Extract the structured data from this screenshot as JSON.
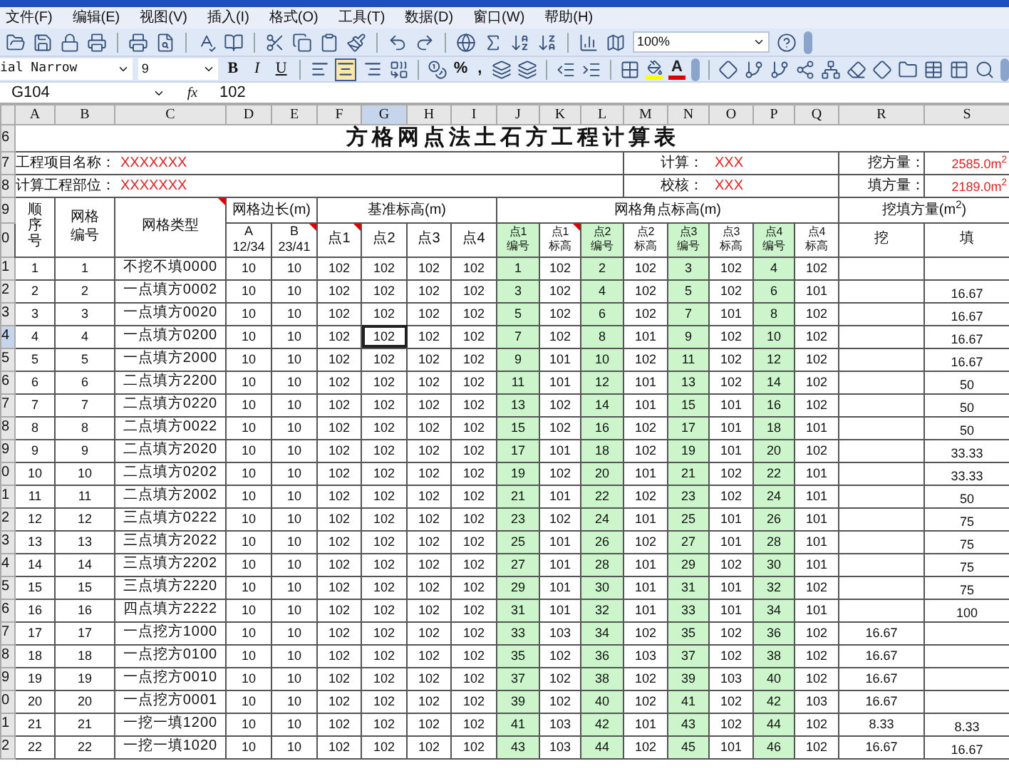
{
  "menu": [
    "文件(F)",
    "编辑(E)",
    "视图(V)",
    "插入(I)",
    "格式(O)",
    "工具(T)",
    "数据(D)",
    "窗口(W)",
    "帮助(H)"
  ],
  "toolbar": {
    "zoom": "100%",
    "font": "ial Narrow",
    "size": "9",
    "style_buttons": [
      "B",
      "I",
      "U"
    ],
    "align_buttons": [
      {
        "selected": false
      },
      {
        "selected": true
      },
      {
        "selected": false
      }
    ],
    "percent": "%",
    "comma": ",",
    "font_color": "A"
  },
  "formula_bar": {
    "name_box": "G104",
    "fx": "fx",
    "value": "102"
  },
  "columns": [
    {
      "label": "A",
      "selected": false
    },
    {
      "label": "B",
      "selected": false
    },
    {
      "label": "C",
      "selected": false
    },
    {
      "label": "D",
      "selected": false
    },
    {
      "label": "E",
      "selected": false
    },
    {
      "label": "F",
      "selected": false
    },
    {
      "label": "G",
      "selected": true
    },
    {
      "label": "H",
      "selected": false
    },
    {
      "label": "I",
      "selected": false
    },
    {
      "label": "J",
      "selected": false
    },
    {
      "label": "K",
      "selected": false
    },
    {
      "label": "L",
      "selected": false
    },
    {
      "label": "M",
      "selected": false
    },
    {
      "label": "N",
      "selected": false
    },
    {
      "label": "O",
      "selected": false
    },
    {
      "label": "P",
      "selected": false
    },
    {
      "label": "Q",
      "selected": false
    },
    {
      "label": "R",
      "selected": false
    },
    {
      "label": "S",
      "selected": false
    }
  ],
  "title": {
    "row": "6",
    "text": "方格网点法土石方工程计算表"
  },
  "info": [
    {
      "row": "7",
      "label": "工程项目名称：",
      "value": "XXXXXXX",
      "check_label": "计算：",
      "check_value": "XXX",
      "total_label": "挖方量：",
      "total_value": "2585.0m$^{2}$"
    },
    {
      "row": "8",
      "label": "计算工程部位：",
      "value": "XXXXXXX",
      "check_label": "校核：",
      "check_value": "XXX",
      "total_label": "填方量：",
      "total_value": "2189.0m$^{2}$"
    }
  ],
  "header": {
    "row_labels": [
      "9",
      "0"
    ],
    "seq": "顺序号",
    "code": "网格编号",
    "type": {
      "text": "网格类型",
      "comment": true
    },
    "side": "网格边长(m)",
    "side_cols": [
      {
        "name": "A",
        "sub": "12/34",
        "comment": false
      },
      {
        "name": "B",
        "sub": "23/41",
        "comment": true
      }
    ],
    "base": "基准标高(m)",
    "base_cols": [
      {
        "text": "点1",
        "comment": true
      },
      {
        "text": "点2",
        "comment": false
      },
      {
        "text": "点3",
        "comment": false
      },
      {
        "text": "点4",
        "comment": false
      }
    ],
    "corner": "网格角点标高(m)",
    "corner_cols": [
      {
        "point": "点1",
        "field": "编号",
        "comment": false
      },
      {
        "point": "点1",
        "field": "标高",
        "comment": true
      },
      {
        "point": "点2",
        "field": "编号",
        "comment": false
      },
      {
        "point": "点2",
        "field": "标高",
        "comment": false
      },
      {
        "point": "点3",
        "field": "编号",
        "comment": false
      },
      {
        "point": "点3",
        "field": "标高",
        "comment": false
      },
      {
        "point": "点4",
        "field": "编号",
        "comment": false
      },
      {
        "point": "点4",
        "field": "标高",
        "comment": false
      }
    ],
    "volume": "挖填方量(m$^{2}$)",
    "volume_cols": [
      "挖",
      "填"
    ]
  },
  "rows": [
    {
      "row": "1",
      "selected": false,
      "no": "1",
      "code": "1",
      "type": "不挖不填0000",
      "a": "10",
      "b": "10",
      "base": [
        "102",
        "102",
        "102",
        "102"
      ],
      "corners": [
        "1",
        "102",
        "2",
        "102",
        "3",
        "102",
        "4",
        "102"
      ]
    },
    {
      "row": "2",
      "selected": false,
      "no": "2",
      "code": "2",
      "type": "一点填方0002",
      "a": "10",
      "b": "10",
      "base": [
        "102",
        "102",
        "102",
        "102"
      ],
      "corners": [
        "3",
        "102",
        "4",
        "102",
        "5",
        "102",
        "6",
        "101"
      ],
      "fill": "16.67"
    },
    {
      "row": "3",
      "selected": false,
      "no": "3",
      "code": "3",
      "type": "一点填方0020",
      "a": "10",
      "b": "10",
      "base": [
        "102",
        "102",
        "102",
        "102"
      ],
      "corners": [
        "5",
        "102",
        "6",
        "102",
        "7",
        "101",
        "8",
        "102"
      ],
      "fill": "16.67"
    },
    {
      "row": "4",
      "selected": true,
      "no": "4",
      "code": "4",
      "type": "一点填方0200",
      "a": "10",
      "b": "10",
      "base": [
        "102",
        "102",
        "102",
        "102"
      ],
      "corners": [
        "7",
        "102",
        "8",
        "101",
        "9",
        "102",
        "10",
        "102"
      ],
      "fill": "16.67"
    },
    {
      "row": "5",
      "selected": false,
      "no": "5",
      "code": "5",
      "type": "一点填方2000",
      "a": "10",
      "b": "10",
      "base": [
        "102",
        "102",
        "102",
        "102"
      ],
      "corners": [
        "9",
        "101",
        "10",
        "102",
        "11",
        "102",
        "12",
        "102"
      ],
      "fill": "16.67"
    },
    {
      "row": "6",
      "selected": false,
      "no": "6",
      "code": "6",
      "type": "二点填方2200",
      "a": "10",
      "b": "10",
      "base": [
        "102",
        "102",
        "102",
        "102"
      ],
      "corners": [
        "11",
        "101",
        "12",
        "101",
        "13",
        "102",
        "14",
        "102"
      ],
      "fill": "50"
    },
    {
      "row": "7",
      "selected": false,
      "no": "7",
      "code": "7",
      "type": "二点填方0220",
      "a": "10",
      "b": "10",
      "base": [
        "102",
        "102",
        "102",
        "102"
      ],
      "corners": [
        "13",
        "102",
        "14",
        "101",
        "15",
        "101",
        "16",
        "102"
      ],
      "fill": "50"
    },
    {
      "row": "8",
      "selected": false,
      "no": "8",
      "code": "8",
      "type": "二点填方0022",
      "a": "10",
      "b": "10",
      "base": [
        "102",
        "102",
        "102",
        "102"
      ],
      "corners": [
        "15",
        "102",
        "16",
        "102",
        "17",
        "101",
        "18",
        "101"
      ],
      "fill": "50"
    },
    {
      "row": "9",
      "selected": false,
      "no": "9",
      "code": "9",
      "type": "二点填方2020",
      "a": "10",
      "b": "10",
      "base": [
        "102",
        "102",
        "102",
        "102"
      ],
      "corners": [
        "17",
        "101",
        "18",
        "102",
        "19",
        "101",
        "20",
        "102"
      ],
      "fill": "33.33"
    },
    {
      "row": "0",
      "selected": false,
      "no": "10",
      "code": "10",
      "type": "二点填方0202",
      "a": "10",
      "b": "10",
      "base": [
        "102",
        "102",
        "102",
        "102"
      ],
      "corners": [
        "19",
        "102",
        "20",
        "101",
        "21",
        "102",
        "22",
        "101"
      ],
      "fill": "33.33"
    },
    {
      "row": "1",
      "selected": false,
      "no": "11",
      "code": "11",
      "type": "二点填方2002",
      "a": "10",
      "b": "10",
      "base": [
        "102",
        "102",
        "102",
        "102"
      ],
      "corners": [
        "21",
        "101",
        "22",
        "102",
        "23",
        "102",
        "24",
        "101"
      ],
      "fill": "50"
    },
    {
      "row": "2",
      "selected": false,
      "no": "12",
      "code": "12",
      "type": "三点填方0222",
      "a": "10",
      "b": "10",
      "base": [
        "102",
        "102",
        "102",
        "102"
      ],
      "corners": [
        "23",
        "102",
        "24",
        "101",
        "25",
        "101",
        "26",
        "101"
      ],
      "fill": "75"
    },
    {
      "row": "3",
      "selected": false,
      "no": "13",
      "code": "13",
      "type": "三点填方2022",
      "a": "10",
      "b": "10",
      "base": [
        "102",
        "102",
        "102",
        "102"
      ],
      "corners": [
        "25",
        "101",
        "26",
        "102",
        "27",
        "101",
        "28",
        "101"
      ],
      "fill": "75"
    },
    {
      "row": "4",
      "selected": false,
      "no": "14",
      "code": "14",
      "type": "三点填方2202",
      "a": "10",
      "b": "10",
      "base": [
        "102",
        "102",
        "102",
        "102"
      ],
      "corners": [
        "27",
        "101",
        "28",
        "101",
        "29",
        "102",
        "30",
        "101"
      ],
      "fill": "75"
    },
    {
      "row": "5",
      "selected": false,
      "no": "15",
      "code": "15",
      "type": "三点填方2220",
      "a": "10",
      "b": "10",
      "base": [
        "102",
        "102",
        "102",
        "102"
      ],
      "corners": [
        "29",
        "101",
        "30",
        "101",
        "31",
        "101",
        "32",
        "102"
      ],
      "fill": "75"
    },
    {
      "row": "6",
      "selected": false,
      "no": "16",
      "code": "16",
      "type": "四点填方2222",
      "a": "10",
      "b": "10",
      "base": [
        "102",
        "102",
        "102",
        "102"
      ],
      "corners": [
        "31",
        "101",
        "32",
        "101",
        "33",
        "101",
        "34",
        "101"
      ],
      "fill": "100"
    },
    {
      "row": "7",
      "selected": false,
      "no": "17",
      "code": "17",
      "type": "一点挖方1000",
      "a": "10",
      "b": "10",
      "base": [
        "102",
        "102",
        "102",
        "102"
      ],
      "corners": [
        "33",
        "103",
        "34",
        "102",
        "35",
        "102",
        "36",
        "102"
      ],
      "cut": "16.67"
    },
    {
      "row": "8",
      "selected": false,
      "no": "18",
      "code": "18",
      "type": "一点挖方0100",
      "a": "10",
      "b": "10",
      "base": [
        "102",
        "102",
        "102",
        "102"
      ],
      "corners": [
        "35",
        "102",
        "36",
        "103",
        "37",
        "102",
        "38",
        "102"
      ],
      "cut": "16.67"
    },
    {
      "row": "9",
      "selected": false,
      "no": "19",
      "code": "19",
      "type": "一点挖方0010",
      "a": "10",
      "b": "10",
      "base": [
        "102",
        "102",
        "102",
        "102"
      ],
      "corners": [
        "37",
        "102",
        "38",
        "102",
        "39",
        "103",
        "40",
        "102"
      ],
      "cut": "16.67"
    },
    {
      "row": "0",
      "selected": false,
      "no": "20",
      "code": "20",
      "type": "一点挖方0001",
      "a": "10",
      "b": "10",
      "base": [
        "102",
        "102",
        "102",
        "102"
      ],
      "corners": [
        "39",
        "102",
        "40",
        "102",
        "41",
        "102",
        "42",
        "103"
      ],
      "cut": "16.67"
    },
    {
      "row": "1",
      "selected": false,
      "no": "21",
      "code": "21",
      "type": "一挖一填1200",
      "a": "10",
      "b": "10",
      "base": [
        "102",
        "102",
        "102",
        "102"
      ],
      "corners": [
        "41",
        "103",
        "42",
        "101",
        "43",
        "102",
        "44",
        "102"
      ],
      "cut": "8.33",
      "fill": "8.33"
    },
    {
      "row": "2",
      "selected": false,
      "no": "22",
      "code": "22",
      "type": "一挖一填1020",
      "a": "10",
      "b": "10",
      "base": [
        "102",
        "102",
        "102",
        "102"
      ],
      "corners": [
        "43",
        "103",
        "44",
        "102",
        "45",
        "101",
        "46",
        "102"
      ],
      "cut": "16.67",
      "fill": "16.67"
    }
  ]
}
